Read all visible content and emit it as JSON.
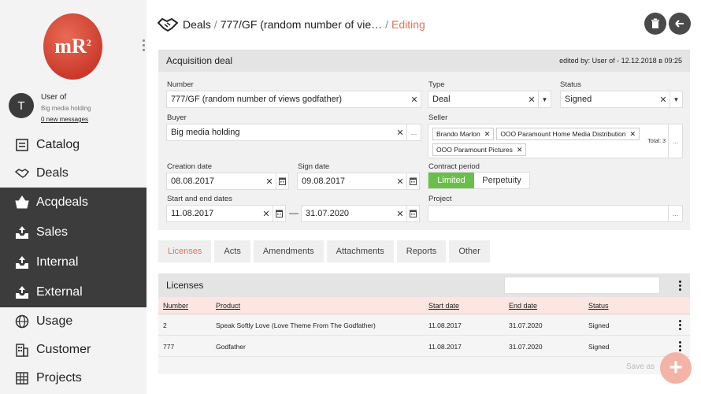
{
  "sidebar": {
    "logo_text": "mR",
    "logo_sup": "2",
    "user": {
      "initial": "T",
      "name": "User of",
      "company": "Big media holding",
      "messages": "0 new messages"
    },
    "items": [
      {
        "label": "Catalog",
        "icon": "catalog-icon"
      },
      {
        "label": "Deals",
        "icon": "handshake-icon"
      },
      {
        "label": "Acqdeals",
        "icon": "basket-icon"
      },
      {
        "label": "Sales",
        "icon": "tray-up-icon"
      },
      {
        "label": "Internal",
        "icon": "tray-up-icon"
      },
      {
        "label": "External",
        "icon": "tray-up-icon"
      },
      {
        "label": "Usage",
        "icon": "globe-icon"
      },
      {
        "label": "Customer",
        "icon": "building-icon"
      },
      {
        "label": "Projects",
        "icon": "grid-icon"
      }
    ]
  },
  "header": {
    "section": "Deals",
    "deal": "777/GF (random number of vie…",
    "mode": "Editing",
    "accent": "#e0735e"
  },
  "card": {
    "title": "Acquisition deal",
    "meta": "edited by: User of - 12.12.2018 в 09:25",
    "number_label": "Number",
    "number_value": "777/GF (random number of views godfather)",
    "type_label": "Type",
    "type_value": "Deal",
    "status_label": "Status",
    "status_value": "Signed",
    "buyer_label": "Buyer",
    "buyer_value": "Big media holding",
    "seller_label": "Seller",
    "sellers": [
      "Brando Marlon",
      "OOO Paramount Home Media Distribution",
      "OOO Paramount Pictures"
    ],
    "seller_total": "Total: 3",
    "creation_label": "Creation date",
    "creation_value": "08.08.2017",
    "sign_label": "Sign date",
    "sign_value": "09.08.2017",
    "period_label": "Contract period",
    "period_limited": "Limited",
    "period_perpetuity": "Perpetuity",
    "startend_label": "Start and end dates",
    "start_value": "11.08.2017",
    "end_value": "31.07.2020",
    "dash": "—",
    "project_label": "Project",
    "project_value": ""
  },
  "tabs": [
    "Licenses",
    "Acts",
    "Amendments",
    "Attachments",
    "Reports",
    "Other"
  ],
  "licenses": {
    "title": "Licenses",
    "columns": [
      "Number",
      "Product",
      "Start date",
      "End date",
      "Status"
    ],
    "rows": [
      [
        "2",
        "Speak Softly Love (Love Theme From The Godfather)",
        "11.08.2017",
        "31.07.2020",
        "Signed"
      ],
      [
        "777",
        "Godfather",
        "11.08.2017",
        "31.07.2020",
        "Signed"
      ]
    ]
  },
  "save_as": "Save as",
  "fab": "+"
}
